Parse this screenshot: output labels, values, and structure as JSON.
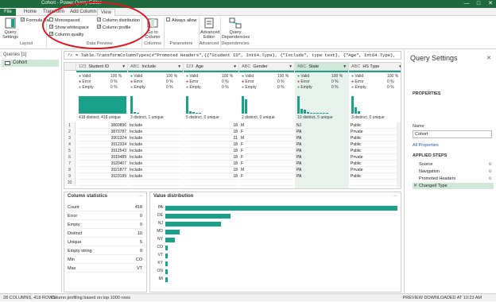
{
  "window": {
    "title": "Cohort - Power Query Editor",
    "min": "—",
    "max": "□",
    "close": "✕"
  },
  "tabs": [
    "File",
    "Home",
    "Transform",
    "Add Column",
    "View"
  ],
  "ribbon": {
    "query_settings": "Query Settings",
    "formula_bar": "Formula Bar",
    "layout_label": "Layout",
    "monospaced": "Monospaced",
    "show_whitespace": "Show whitespace",
    "column_quality": "Column quality",
    "column_distribution": "Column distribution",
    "column_profile": "Column profile",
    "data_preview_label": "Data Preview",
    "go_to_column": "Go to Column",
    "columns_label": "Columns",
    "always_allow": "Always allow",
    "parameters_label": "Parameters",
    "advanced_editor": "Advanced Editor",
    "advanced_label": "Advanced",
    "query_dependencies": "Query Dependencies",
    "dependencies_label": "Dependencies"
  },
  "queries": {
    "header": "Queries [1]",
    "items": [
      "Cohort"
    ]
  },
  "formula": {
    "fx": "fx",
    "text": "= Table.TransformColumnTypes(#\"Promoted Headers\",{{\"Student ID\", Int64.Type}, {\"Include\", type text}, {\"Age\", Int64.Type},"
  },
  "grid": {
    "columns": [
      {
        "name": "Student ID",
        "type": "123",
        "valid": "100 %",
        "error": "0 %",
        "empty": "0 %",
        "dist": "418 distinct, 418 unique"
      },
      {
        "name": "Include",
        "type": "ABC",
        "valid": "100 %",
        "error": "0 %",
        "empty": "0 %",
        "dist": "3 distinct, 1 unique"
      },
      {
        "name": "Age",
        "type": "123",
        "valid": "100 %",
        "error": "0 %",
        "empty": "0 %",
        "dist": "5 distinct, 0 unique"
      },
      {
        "name": "Gender",
        "type": "ABC",
        "valid": "100 %",
        "error": "0 %",
        "empty": "0 %",
        "dist": "2 distinct, 0 unique"
      },
      {
        "name": "State",
        "type": "ABC",
        "valid": "100 %",
        "error": "0 %",
        "empty": "0 %",
        "dist": "10 distinct, 5 unique"
      },
      {
        "name": "HS Type",
        "type": "ABC",
        "valid": "100 %",
        "error": "0 %",
        "empty": "0 %",
        "dist": "3 distinct, 0 unique"
      }
    ],
    "quality_labels": {
      "valid": "Valid",
      "error": "Error",
      "empty": "Empty"
    },
    "rows": [
      [
        "1",
        "3860896",
        "Include",
        "18",
        "M",
        "NJ",
        "Public"
      ],
      [
        "2",
        "3873787",
        "Include",
        "18",
        "F",
        "PA",
        "Private"
      ],
      [
        "3",
        "3901324",
        "Include",
        "21",
        "M",
        "PA",
        "Public"
      ],
      [
        "4",
        "3912334",
        "Include",
        "18",
        "F",
        "PA",
        "Public"
      ],
      [
        "5",
        "3912543",
        "Include",
        "18",
        "F",
        "PA",
        "Public"
      ],
      [
        "6",
        "3919489",
        "Include",
        "18",
        "F",
        "PA",
        "Private"
      ],
      [
        "7",
        "3920407",
        "Include",
        "18",
        "F",
        "PA",
        "Public"
      ],
      [
        "8",
        "3921877",
        "Include",
        "18",
        "M",
        "PA",
        "Private"
      ],
      [
        "9",
        "3923189",
        "Include",
        "18",
        "F",
        "PA",
        "Public"
      ],
      [
        "10",
        "",
        "",
        "",
        "",
        "",
        ""
      ]
    ]
  },
  "column_statistics": {
    "title": "Column statistics",
    "rows": [
      {
        "label": "Count",
        "value": "418"
      },
      {
        "label": "Error",
        "value": "0"
      },
      {
        "label": "Empty",
        "value": "0"
      },
      {
        "label": "Distinct",
        "value": "10"
      },
      {
        "label": "Unique",
        "value": "5"
      },
      {
        "label": "Empty string",
        "value": "0"
      },
      {
        "label": "Min",
        "value": "CO"
      },
      {
        "label": "Max",
        "value": "VT"
      }
    ]
  },
  "value_distribution": {
    "title": "Value distribution",
    "bars": [
      {
        "label": "PA",
        "value": 1.0
      },
      {
        "label": "DE",
        "value": 0.28
      },
      {
        "label": "NJ",
        "value": 0.24
      },
      {
        "label": "MD",
        "value": 0.06
      },
      {
        "label": "NY",
        "value": 0.04
      },
      {
        "label": "CO",
        "value": 0.01
      },
      {
        "label": "VT",
        "value": 0.01
      },
      {
        "label": "KY",
        "value": 0.01
      },
      {
        "label": "ON",
        "value": 0.01
      },
      {
        "label": "MI",
        "value": 0.01
      }
    ]
  },
  "settings": {
    "title": "Query Settings",
    "properties": "PROPERTIES",
    "name_label": "Name",
    "name_value": "Cohort",
    "all_properties": "All Properties",
    "applied_steps": "APPLIED STEPS",
    "steps": [
      "Source",
      "Navigation",
      "Promoted Headers",
      "Changed Type"
    ]
  },
  "status": {
    "left": "28 COLUMNS, 418 ROWS",
    "profiling": "Column profiling based on top 1000 rows",
    "right": "PREVIEW DOWNLOADED AT 10:23 AM"
  },
  "colors": {
    "accent": "#1aa18a",
    "title_bar": "#1e6a3c",
    "highlight": "#e0141e",
    "selected": "#cfe8d8"
  }
}
